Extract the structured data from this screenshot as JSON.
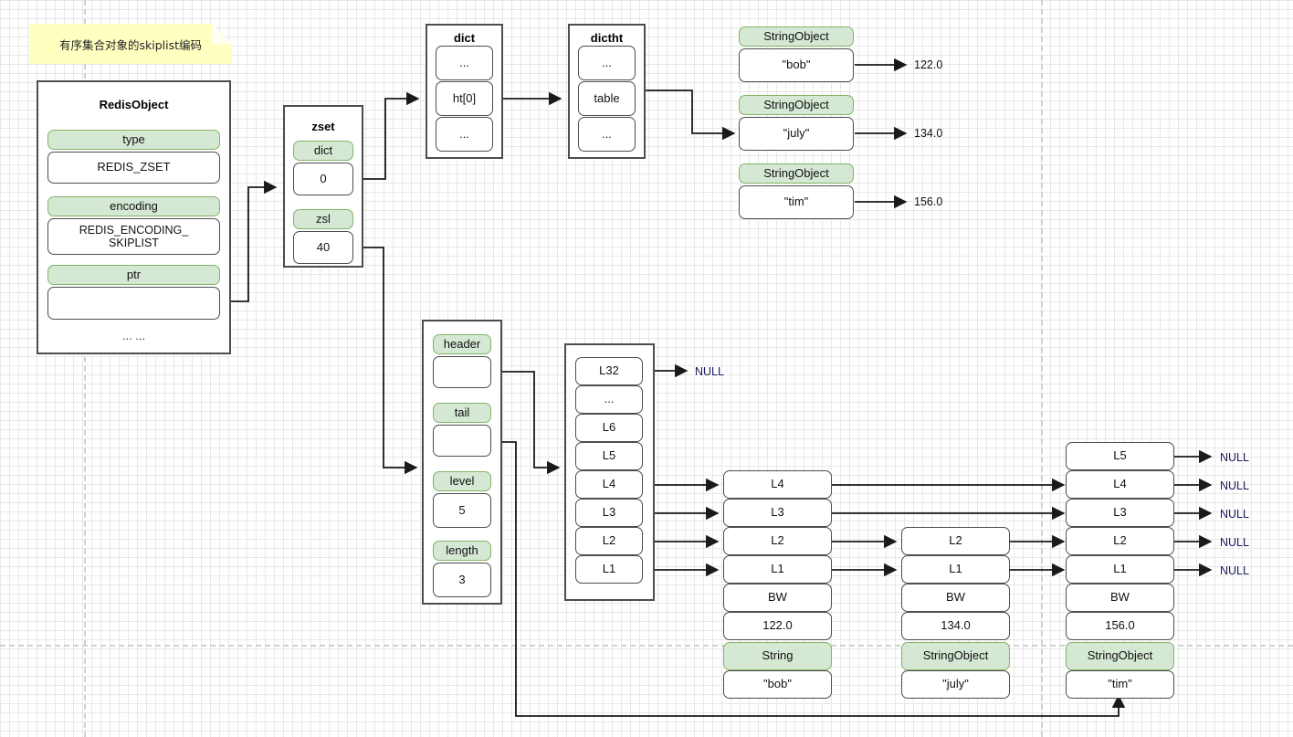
{
  "note": {
    "text": "有序集合对象的skiplist编码"
  },
  "redisobject": {
    "title": "RedisObject",
    "fields": [
      {
        "label": "type",
        "value": "REDIS_ZSET"
      },
      {
        "label": "encoding",
        "value": "REDIS_ENCODING_\nSKIPLIST"
      },
      {
        "label": "ptr",
        "value": ""
      }
    ],
    "ellipsis": "... ..."
  },
  "zset": {
    "title": "zset",
    "fields": [
      {
        "label": "dict",
        "value": "0"
      },
      {
        "label": "zsl",
        "value": "40"
      }
    ]
  },
  "dict": {
    "title": "dict",
    "cells": [
      "...",
      "ht[0]",
      "..."
    ]
  },
  "dictht": {
    "title": "dictht",
    "cells": [
      "...",
      "table",
      "..."
    ]
  },
  "hash_entries": [
    {
      "label": "StringObject",
      "key": "\"bob\"",
      "score": "122.0"
    },
    {
      "label": "StringObject",
      "key": "\"july\"",
      "score": "134.0"
    },
    {
      "label": "StringObject",
      "key": "\"tim\"",
      "score": "156.0"
    }
  ],
  "zskiplist": {
    "fields": [
      {
        "label": "header",
        "value": ""
      },
      {
        "label": "tail",
        "value": ""
      },
      {
        "label": "level",
        "value": "5"
      },
      {
        "label": "length",
        "value": "3"
      }
    ]
  },
  "header_node": {
    "levels": [
      "L32",
      "...",
      "L6",
      "L5",
      "L4",
      "L3",
      "L2",
      "L1"
    ],
    "forward_null": "NULL"
  },
  "skiplist_nodes": [
    {
      "levels": [
        "L4",
        "L3",
        "L2",
        "L1"
      ],
      "backward": "BW",
      "score": "122.0",
      "obj_label": "String",
      "obj_value": "\"bob\""
    },
    {
      "levels": [
        "L2",
        "L1"
      ],
      "backward": "BW",
      "score": "134.0",
      "obj_label": "StringObject",
      "obj_value": "\"july\""
    },
    {
      "levels": [
        "L5",
        "L4",
        "L3",
        "L2",
        "L1"
      ],
      "backward": "BW",
      "score": "156.0",
      "obj_label": "StringObject",
      "obj_value": "\"tim\""
    }
  ],
  "tail_nulls": [
    "NULL",
    "NULL",
    "NULL",
    "NULL",
    "NULL"
  ],
  "colors": {
    "green_fill": "#d5e8d4",
    "green_stroke": "#82b366",
    "box_stroke": "#4d4d4d",
    "note_fill": "#ffffc0",
    "null_text": "#1a1a5e"
  }
}
